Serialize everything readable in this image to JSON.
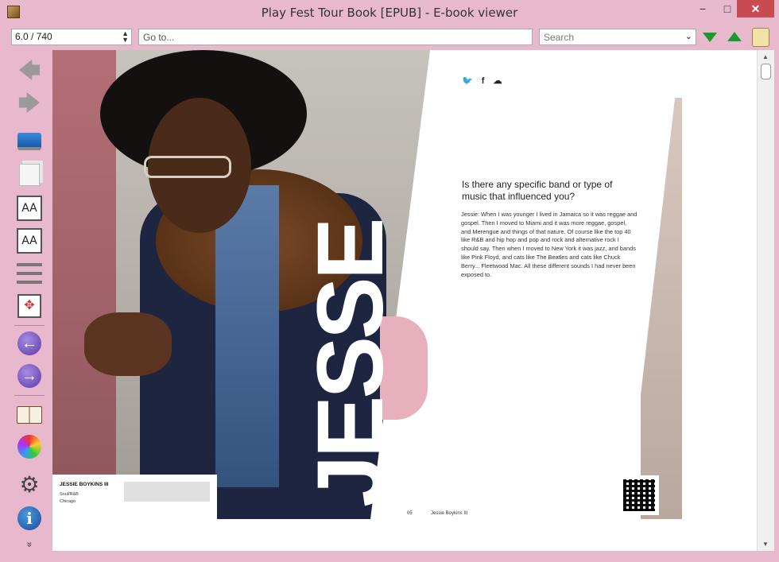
{
  "window": {
    "title": "Play Fest Tour Book [EPUB] - E-book viewer",
    "minimize": "−",
    "maximize": "□",
    "close": "✕"
  },
  "toolbar": {
    "page_position": "6.0 / 740",
    "goto_placeholder": "Go to...",
    "search_placeholder": "Search"
  },
  "sidebar": {
    "back": "🡄",
    "forward": "🡆",
    "font_larger": "AA",
    "font_smaller": "AA",
    "prev_page": "←",
    "next_page": "→",
    "info": "i",
    "more": "»"
  },
  "page": {
    "social_icons": [
      "twitter-icon",
      "facebook-icon",
      "soundcloud-icon"
    ],
    "social_labels": [
      "🐦",
      "f",
      "☁"
    ],
    "question": "Is there any specific band or type of music that influenced you?",
    "answer": "Jessie: When I was younger I lived in Jamaica so it was reggae and gospel. Then I moved to Miami and it was more reggae, gospel, and Merengue and things of that nature. Of course like the top 40 like R&B and hip hop and pop and rock and alternative rock I should say. Then when I moved to New York it was jazz, and bands like Pink Floyd, and cats like The Beatles and cats like Chuck Berry... Fleetwood Mac. All these different sounds I had never been exposed to.",
    "headline": "JESSE",
    "caption": {
      "name": "JESSIE BOYKINS III",
      "genre": "Soul/R&B",
      "city": "Chicago"
    },
    "footer_page": "05",
    "footer_name": "Jessie Boykins III"
  }
}
